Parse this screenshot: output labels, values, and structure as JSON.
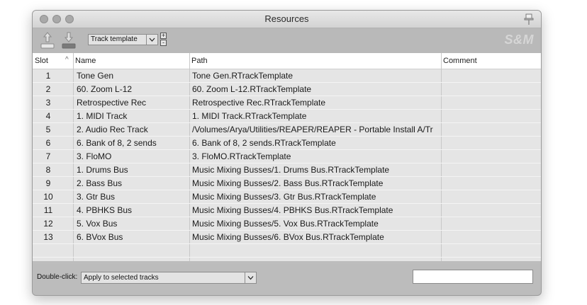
{
  "window": {
    "title": "Resources"
  },
  "toolbar": {
    "resource_type": "Track template",
    "plus_label": "+",
    "minus_label": "-",
    "logo_text": "S&M"
  },
  "table": {
    "columns": {
      "slot": "Slot",
      "name": "Name",
      "path": "Path",
      "comment": "Comment"
    },
    "sort_indicator": "^",
    "rows": [
      {
        "slot": "1",
        "name": "Tone Gen",
        "path": "Tone Gen.RTrackTemplate",
        "comment": ""
      },
      {
        "slot": "2",
        "name": "60. Zoom L-12",
        "path": "60. Zoom L-12.RTrackTemplate",
        "comment": ""
      },
      {
        "slot": "3",
        "name": "Retrospective Rec",
        "path": "Retrospective Rec.RTrackTemplate",
        "comment": ""
      },
      {
        "slot": "4",
        "name": "1. MIDI Track",
        "path": "1. MIDI Track.RTrackTemplate",
        "comment": ""
      },
      {
        "slot": "5",
        "name": "2. Audio Rec Track",
        "path": "/Volumes/Arya/Utilities/REAPER/REAPER - Portable Install A/Tr",
        "comment": ""
      },
      {
        "slot": "6",
        "name": "6. Bank of 8, 2 sends",
        "path": "6. Bank of 8, 2 sends.RTrackTemplate",
        "comment": ""
      },
      {
        "slot": "7",
        "name": "3. FloMO",
        "path": "3. FloMO.RTrackTemplate",
        "comment": ""
      },
      {
        "slot": "8",
        "name": "1. Drums Bus",
        "path": "Music Mixing Busses/1. Drums Bus.RTrackTemplate",
        "comment": ""
      },
      {
        "slot": "9",
        "name": "2. Bass Bus",
        "path": "Music Mixing Busses/2. Bass Bus.RTrackTemplate",
        "comment": ""
      },
      {
        "slot": "10",
        "name": "3. Gtr Bus",
        "path": "Music Mixing Busses/3. Gtr Bus.RTrackTemplate",
        "comment": ""
      },
      {
        "slot": "11",
        "name": "4. PBHKS Bus",
        "path": "Music Mixing Busses/4. PBHKS Bus.RTrackTemplate",
        "comment": ""
      },
      {
        "slot": "12",
        "name": "5. Vox Bus",
        "path": "Music Mixing Busses/5. Vox Bus.RTrackTemplate",
        "comment": ""
      },
      {
        "slot": "13",
        "name": "6. BVox Bus",
        "path": "Music Mixing Busses/6. BVox Bus.RTrackTemplate",
        "comment": ""
      },
      {
        "slot": "",
        "name": "",
        "path": "",
        "comment": ""
      }
    ]
  },
  "bottom": {
    "double_click_label": "Double-click:",
    "double_click_action": "Apply to selected tracks",
    "filter_value": ""
  },
  "colors": {
    "window_bg": "#bdbdbd",
    "table_bg": "#e5e5e5",
    "logo": "#d6d6d6"
  },
  "icons": [
    "pin-icon",
    "load-up-icon",
    "save-down-icon",
    "chevron-down-icon"
  ]
}
